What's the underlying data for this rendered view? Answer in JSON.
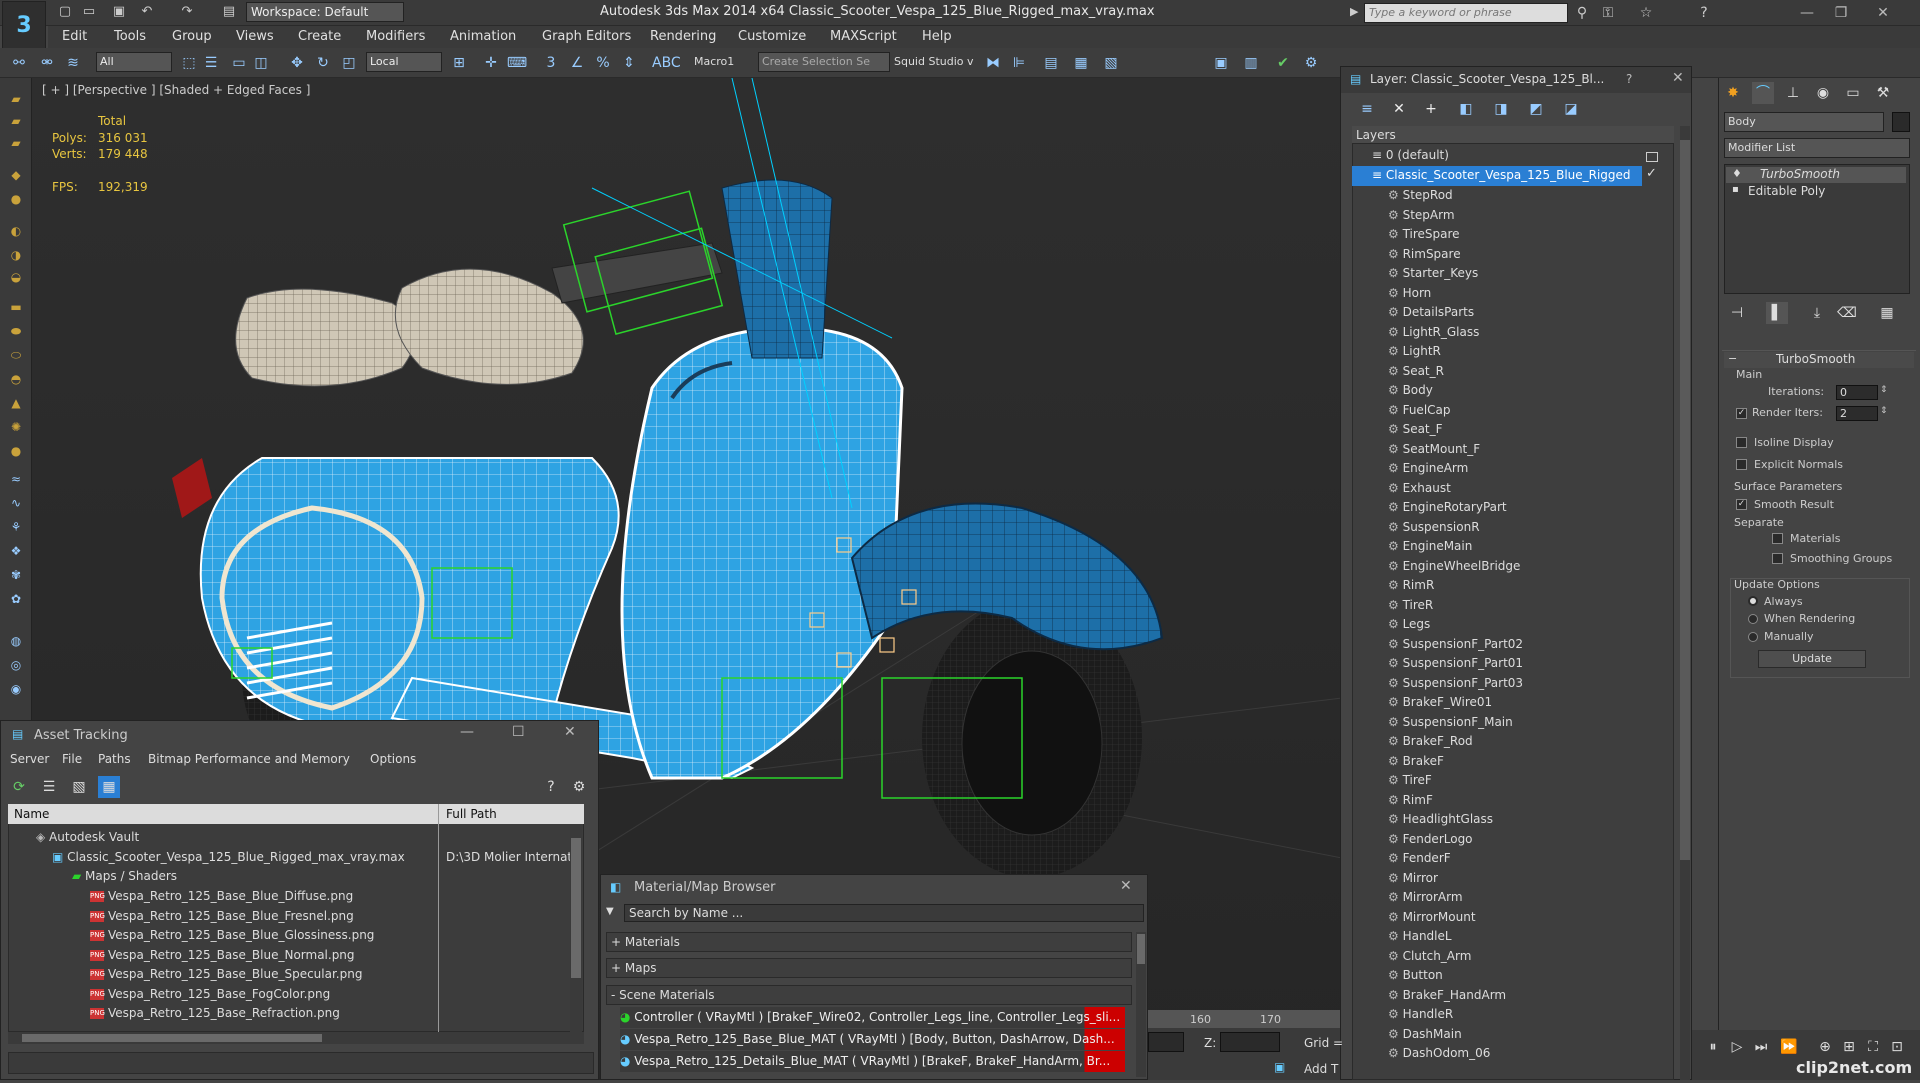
{
  "title_bar": {
    "workspace_label": "Workspace: Default",
    "app_title": "Autodesk 3ds Max  2014 x64     Classic_Scooter_Vespa_125_Blue_Rigged_max_vray.max",
    "search_placeholder": "Type a keyword or phrase"
  },
  "menu": [
    "Edit",
    "Tools",
    "Group",
    "Views",
    "Create",
    "Modifiers",
    "Animation",
    "Graph Editors",
    "Rendering",
    "Customize",
    "MAXScript",
    "Help"
  ],
  "toolbar": {
    "filter": "All",
    "coord": "Local",
    "macro": "Macro1",
    "selection_set": "Create Selection Se",
    "squid": "Squid Studio v"
  },
  "viewport": {
    "label": "[ + ] [Perspective ] [Shaded + Edged Faces ]",
    "stats_header": "Total",
    "polys_label": "Polys:",
    "polys_value": "316 031",
    "verts_label": "Verts:",
    "verts_value": "179 448",
    "fps_label": "FPS:",
    "fps_value": "192,319"
  },
  "layer_explorer": {
    "title": "Layer: Classic_Scooter_Vespa_125_Bl...",
    "help": "?",
    "header": "Layers",
    "default_layer": "0 (default)",
    "active_layer": "Classic_Scooter_Vespa_125_Blue_Rigged",
    "items": [
      "StepRod",
      "StepArm",
      "TireSpare",
      "RimSpare",
      "Starter_Keys",
      "Horn",
      "DetailsParts",
      "LightR_Glass",
      "LightR",
      "Seat_R",
      "Body",
      "FuelCap",
      "Seat_F",
      "SeatMount_F",
      "EngineArm",
      "Exhaust",
      "EngineRotaryPart",
      "SuspensionR",
      "EngineMain",
      "EngineWheelBridge",
      "RimR",
      "TireR",
      "Legs",
      "SuspensionF_Part02",
      "SuspensionF_Part01",
      "SuspensionF_Part03",
      "BrakeF_Wire01",
      "SuspensionF_Main",
      "BrakeF_Rod",
      "BrakeF",
      "TireF",
      "RimF",
      "HeadlightGlass",
      "FenderLogo",
      "FenderF",
      "Mirror",
      "MirrorArm",
      "MirrorMount",
      "HandleL",
      "Clutch_Arm",
      "Button",
      "BrakeF_HandArm",
      "HandleR",
      "DashMain",
      "DashOdom_06"
    ]
  },
  "command_panel": {
    "object_name": "Body",
    "modifier_list": "Modifier List",
    "stack": [
      "TurboSmooth",
      "Editable Poly"
    ],
    "rollout_title": "TurboSmooth",
    "main_label": "Main",
    "iterations_label": "Iterations:",
    "iterations_value": "0",
    "render_iters_label": "Render Iters:",
    "render_iters_value": "2",
    "isoline_label": "Isoline Display",
    "explicit_normals_label": "Explicit Normals",
    "surface_params_label": "Surface Parameters",
    "smooth_result_label": "Smooth Result",
    "separate_label": "Separate",
    "materials_label": "Materials",
    "smoothing_groups_label": "Smoothing Groups",
    "update_options_label": "Update Options",
    "always_label": "Always",
    "when_rendering_label": "When Rendering",
    "manually_label": "Manually",
    "update_button": "Update"
  },
  "asset_tracking": {
    "title": "Asset Tracking",
    "menu": [
      "Server",
      "File",
      "Paths",
      "Bitmap Performance and Memory",
      "Options"
    ],
    "col_name": "Name",
    "col_path": "Full Path",
    "vault": "Autodesk Vault",
    "max_file": "Classic_Scooter_Vespa_125_Blue_Rigged_max_vray.max",
    "max_path": "D:\\3D Molier Internat",
    "maps_folder": "Maps / Shaders",
    "maps": [
      "Vespa_Retro_125_Base_Blue_Diffuse.png",
      "Vespa_Retro_125_Base_Blue_Fresnel.png",
      "Vespa_Retro_125_Base_Blue_Glossiness.png",
      "Vespa_Retro_125_Base_Blue_Normal.png",
      "Vespa_Retro_125_Base_Blue_Specular.png",
      "Vespa_Retro_125_Base_FogColor.png",
      "Vespa_Retro_125_Base_Refraction.png"
    ]
  },
  "material_browser": {
    "title": "Material/Map Browser",
    "search_placeholder": "Search by Name ...",
    "sections": [
      "+ Materials",
      "+ Maps",
      "- Scene Materials"
    ],
    "scene_materials": [
      "Controller ( VRayMtl ) [BrakeF_Wire02, Controller_Legs_line, Controller_Legs_sli...",
      "Vespa_Retro_125_Base_Blue_MAT ( VRayMtl ) [Body, Button, DashArrow, Dash...",
      "Vespa_Retro_125_Details_Blue_MAT ( VRayMtl ) [BrakeF, BrakeF_HandArm, Br..."
    ]
  },
  "timeline": {
    "tick_160": "160",
    "tick_170": "170",
    "z_label": "Z:",
    "grid_label": "Grid =",
    "add_label": "Add T"
  },
  "watermark": "clip2net.com",
  "colors": {
    "accent": "#2a7fd4",
    "scooter_blue": "#2ea3e3",
    "stat_yellow": "#e8c640"
  }
}
